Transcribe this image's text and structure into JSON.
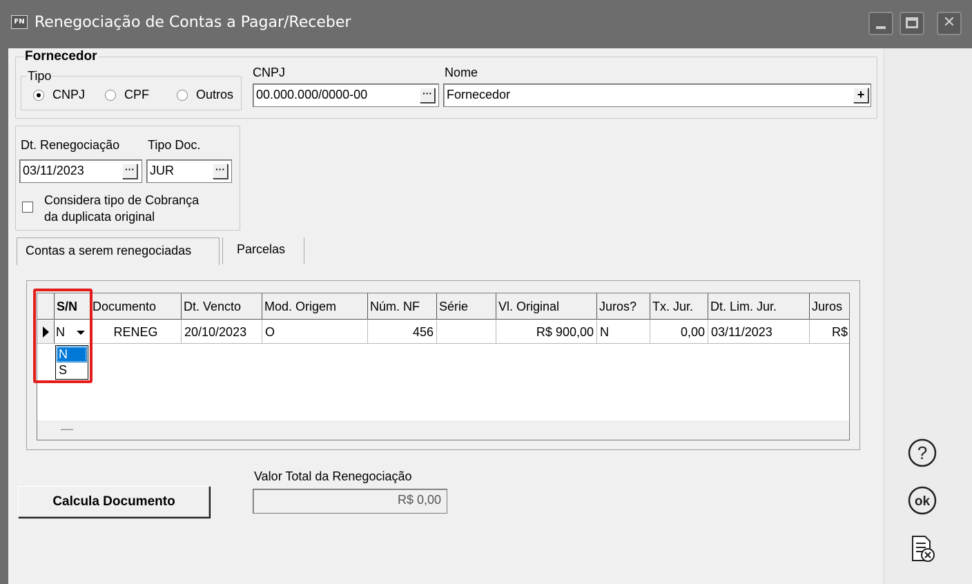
{
  "window": {
    "app_badge": "FN",
    "title": "Renegociação de Contas a Pagar/Receber"
  },
  "fornecedor": {
    "group_label": "Fornecedor",
    "tipo_label": "Tipo",
    "tipo_options": [
      "CNPJ",
      "CPF",
      "Outros"
    ],
    "tipo_selected": "CNPJ",
    "cnpj_label": "CNPJ",
    "cnpj_value": "00.000.000/0000-00",
    "nome_label": "Nome",
    "nome_value": "Fornecedor"
  },
  "doc": {
    "dt_label": "Dt. Renegociação",
    "dt_value": "03/11/2023",
    "tipo_label": "Tipo Doc.",
    "tipo_value": "JUR",
    "considera_line1": "Considera tipo de Cobrança",
    "considera_line2": "da duplicata original",
    "considera_checked": false
  },
  "tabs": [
    {
      "label": "Contas a serem renegociadas",
      "active": true
    },
    {
      "label": "Parcelas",
      "active": false
    }
  ],
  "grid": {
    "columns": [
      "S/N",
      "Documento",
      "Dt. Vencto",
      "Mod. Origem",
      "Núm. NF",
      "Série",
      "Vl. Original",
      "Juros?",
      "Tx. Jur.",
      "Dt. Lim. Jur.",
      "Juros"
    ],
    "rows": [
      {
        "sn": "N",
        "documento": "RENEG",
        "dt_vencto": "20/10/2023",
        "mod_origem": "O",
        "num_nf": "456",
        "serie": "",
        "vl_original": "R$ 900,00",
        "juros_q": "N",
        "tx_jur": "0,00",
        "dt_lim_jur": "03/11/2023",
        "juros": "R$"
      }
    ],
    "dropdown_options": [
      "N",
      "S"
    ],
    "dropdown_selected": "N",
    "footer_mark": "—"
  },
  "bottom": {
    "calc_button": "Calcula Documento",
    "total_label": "Valor Total da Renegociação",
    "total_value": "R$ 0,00"
  },
  "side_buttons": [
    {
      "name": "help-icon",
      "glyph": "?"
    },
    {
      "name": "ok-icon",
      "glyph": "ok"
    },
    {
      "name": "cancel-document-icon",
      "glyph": ""
    }
  ],
  "colors": {
    "titlebar": "#6d6d6d",
    "highlight": "#e41b1b",
    "selection": "#0078d7"
  }
}
